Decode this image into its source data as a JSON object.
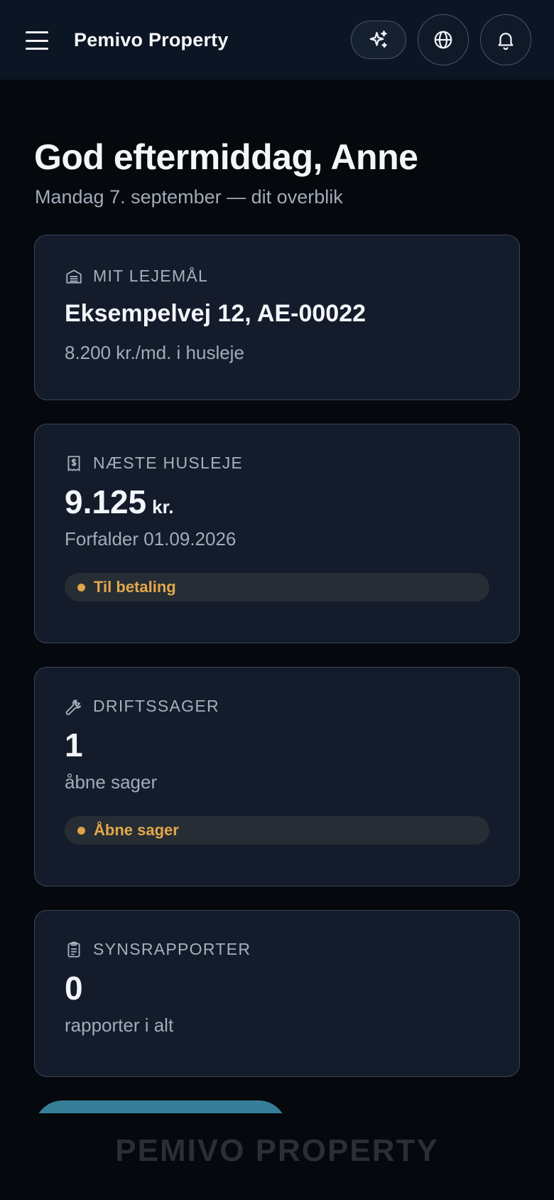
{
  "header": {
    "title": "Pemivo Property",
    "icons": {
      "menu": "hamburger-menu-icon",
      "ai": "sparkle-icon",
      "language": "globe-icon",
      "notifications": "bell-icon"
    }
  },
  "greeting": {
    "title": "God eftermiddag, Anne",
    "subtitle": "Mandag 7. september — dit overblik"
  },
  "cards": {
    "lease": {
      "label": "MIT LEJEMÅL",
      "icon": "building-icon",
      "address": "Eksempelvej 12, AE-00022",
      "rent": "8.200 kr./md. i husleje"
    },
    "next_rent": {
      "label": "NÆSTE HUSLEJE",
      "icon": "receipt-icon",
      "amount": "9.125",
      "unit": "kr.",
      "due": "Forfalder 01.09.2026",
      "status": "Til betaling"
    },
    "operations": {
      "label": "DRIFTSSAGER",
      "icon": "wrench-icon",
      "count": "1",
      "sub": "åbne sager",
      "status": "Åbne sager"
    },
    "inspections": {
      "label": "SYNSRAPPORTER",
      "icon": "clipboard-icon",
      "count": "0",
      "sub": "rapporter i alt"
    }
  },
  "footer": {
    "watermark": "PEMIVO PROPERTY"
  },
  "colors": {
    "background": "#05080d",
    "header": "#0c1523",
    "card": "#141c2c",
    "accent": "#377f98",
    "warning": "#e0a445"
  }
}
